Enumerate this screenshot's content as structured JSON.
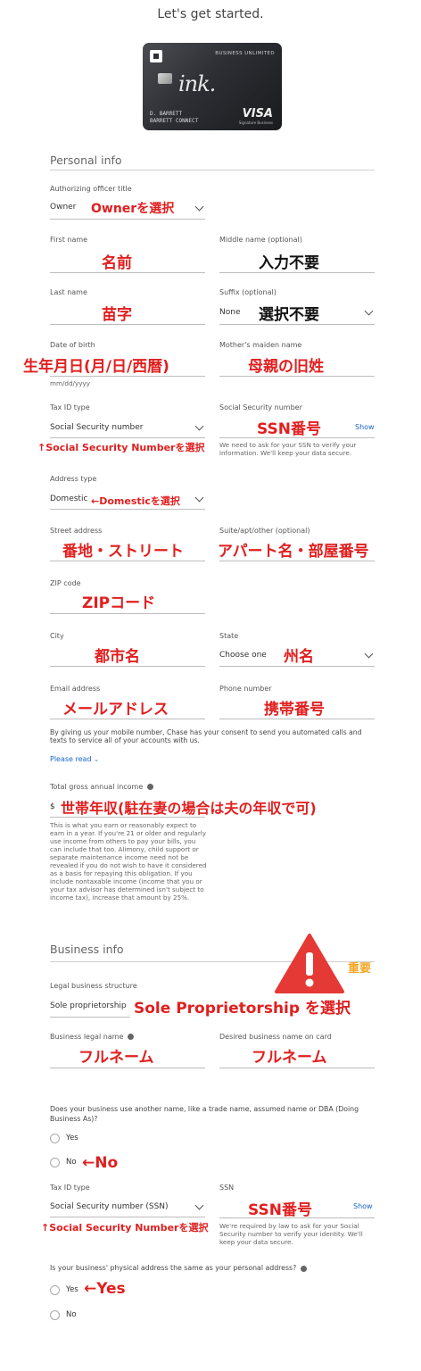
{
  "header": {
    "title": "Let's get started."
  },
  "card": {
    "product": "BUSINESS UNLIMITED",
    "brand_script": "ink.",
    "name_line1": "D. BARRETT",
    "name_line2": "BARRETT CONNECT",
    "network": "VISA",
    "network_sub": "Signature Business"
  },
  "personal": {
    "heading": "Personal info",
    "officer_title": {
      "label": "Authorizing officer title",
      "value": "Owner",
      "note": "Ownerを選択"
    },
    "first_name": {
      "label": "First name",
      "note": "名前"
    },
    "middle_name": {
      "label": "Middle name (optional)",
      "note": "入力不要"
    },
    "last_name": {
      "label": "Last name",
      "note": "苗字"
    },
    "suffix": {
      "label": "Suffix (optional)",
      "value": "None",
      "note": "選択不要"
    },
    "dob": {
      "label": "Date of birth",
      "note": "生年月日(月/日/西暦)",
      "hint": "mm/dd/yyyy"
    },
    "maiden": {
      "label": "Mother's maiden name",
      "note": "母親の旧姓"
    },
    "tax_id_type": {
      "label": "Tax ID type",
      "value": "Social Security number",
      "note": "↑Social Security Numberを選択"
    },
    "ssn": {
      "label": "Social Security number",
      "note": "SSN番号",
      "show": "Show",
      "help": "We need to ask for your SSN to verify your information. We'll keep your data secure."
    },
    "address_type": {
      "label": "Address type",
      "value": "Domestic",
      "note": "←Domesticを選択"
    },
    "street": {
      "label": "Street address",
      "note": "番地・ストリート"
    },
    "suite": {
      "label": "Suite/apt/other (optional)",
      "note": "アパート名・部屋番号"
    },
    "zip": {
      "label": "ZIP code",
      "note": "ZIPコード"
    },
    "city": {
      "label": "City",
      "note": "都市名"
    },
    "state": {
      "label": "State",
      "value": "Choose one",
      "note": "州名"
    },
    "email": {
      "label": "Email address",
      "note": "メールアドレス"
    },
    "phone": {
      "label": "Phone number",
      "note": "携帯番号"
    },
    "consent": "By giving us your mobile number, Chase has your consent to send you automated calls and texts to service all of your accounts with us.",
    "please_read": "Please read",
    "income": {
      "label": "Total gross annual income",
      "prefix": "$",
      "note": "世帯年収(駐在妻の場合は夫の年収で可)",
      "help": "This is what you earn or reasonably expect to earn in a year. If you're 21 or older and regularly use income from others to pay your bills, you can include that too. Alimony, child support or separate maintenance income need not be revealed if you do not wish to have it considered as a basis for repaying this obligation. If you include nontaxable income (income that you or your tax advisor has determined isn't subject to income tax), increase that amount by 25%."
    }
  },
  "business": {
    "heading": "Business info",
    "important": "重要",
    "structure": {
      "label": "Legal business structure",
      "value": "Sole proprietorship",
      "note": "Sole Proprietorship を選択"
    },
    "legal_name": {
      "label": "Business legal name",
      "note": "フルネーム"
    },
    "card_name": {
      "label": "Desired business name on card",
      "note": "フルネーム"
    },
    "dba": {
      "question": "Does your business use another name, like a trade name, assumed name or DBA (Doing Business As)?",
      "yes": "Yes",
      "no": "No",
      "note": "←No"
    },
    "tax_id_type": {
      "label": "Tax ID type",
      "value": "Social Security number (SSN)",
      "note": "↑Social Security Numberを選択"
    },
    "ssn": {
      "label": "SSN",
      "note": "SSN番号",
      "show": "Show",
      "help": "We're required by law to ask for your Social Security number to verify your identity. We'll keep your data secure."
    },
    "same_address": {
      "question": "Is your business' physical address the same as your personal address?",
      "yes": "Yes",
      "no": "No",
      "note": "←Yes"
    }
  },
  "colors": {
    "annotation": "#e11f1f",
    "warning": "#e53935",
    "link": "#1a66c8"
  }
}
